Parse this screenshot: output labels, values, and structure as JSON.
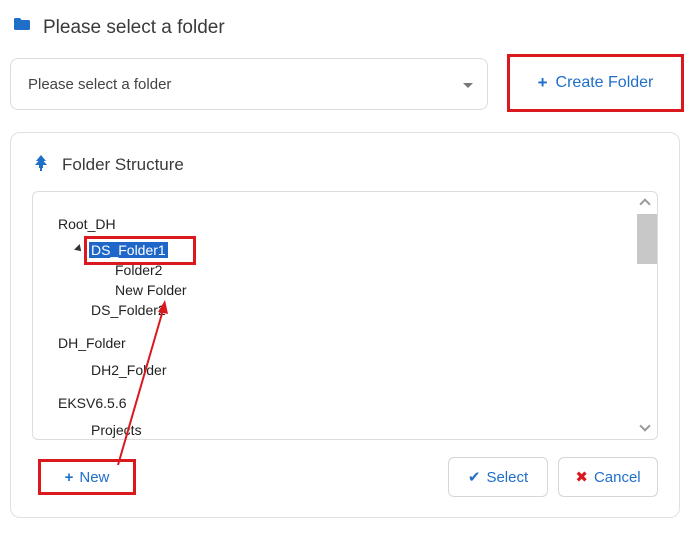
{
  "header": {
    "title": "Please select a folder",
    "icon": "folder-icon"
  },
  "folder_select": {
    "placeholder": "Please select a folder"
  },
  "create_button": {
    "label": "Create Folder",
    "icon": "plus-icon"
  },
  "panel": {
    "title": "Folder Structure",
    "icon": "tree-icon"
  },
  "tree": {
    "root_dh": "Root_DH",
    "ds_folder1": "DS_Folder1",
    "folder2": "Folder2",
    "new_folder": "New Folder",
    "ds_folder2": "DS_Folder2",
    "dh_folder": "DH_Folder",
    "dh2_folder": "DH2_Folder",
    "eksv": "EKSV6.5.6",
    "projects": "Projects"
  },
  "actions": {
    "new_label": "New",
    "select_label": "Select",
    "cancel_label": "Cancel"
  },
  "colors": {
    "accent": "#1f6fc9",
    "highlight": "#d9191e",
    "selected_bg": "#1e66c7"
  }
}
